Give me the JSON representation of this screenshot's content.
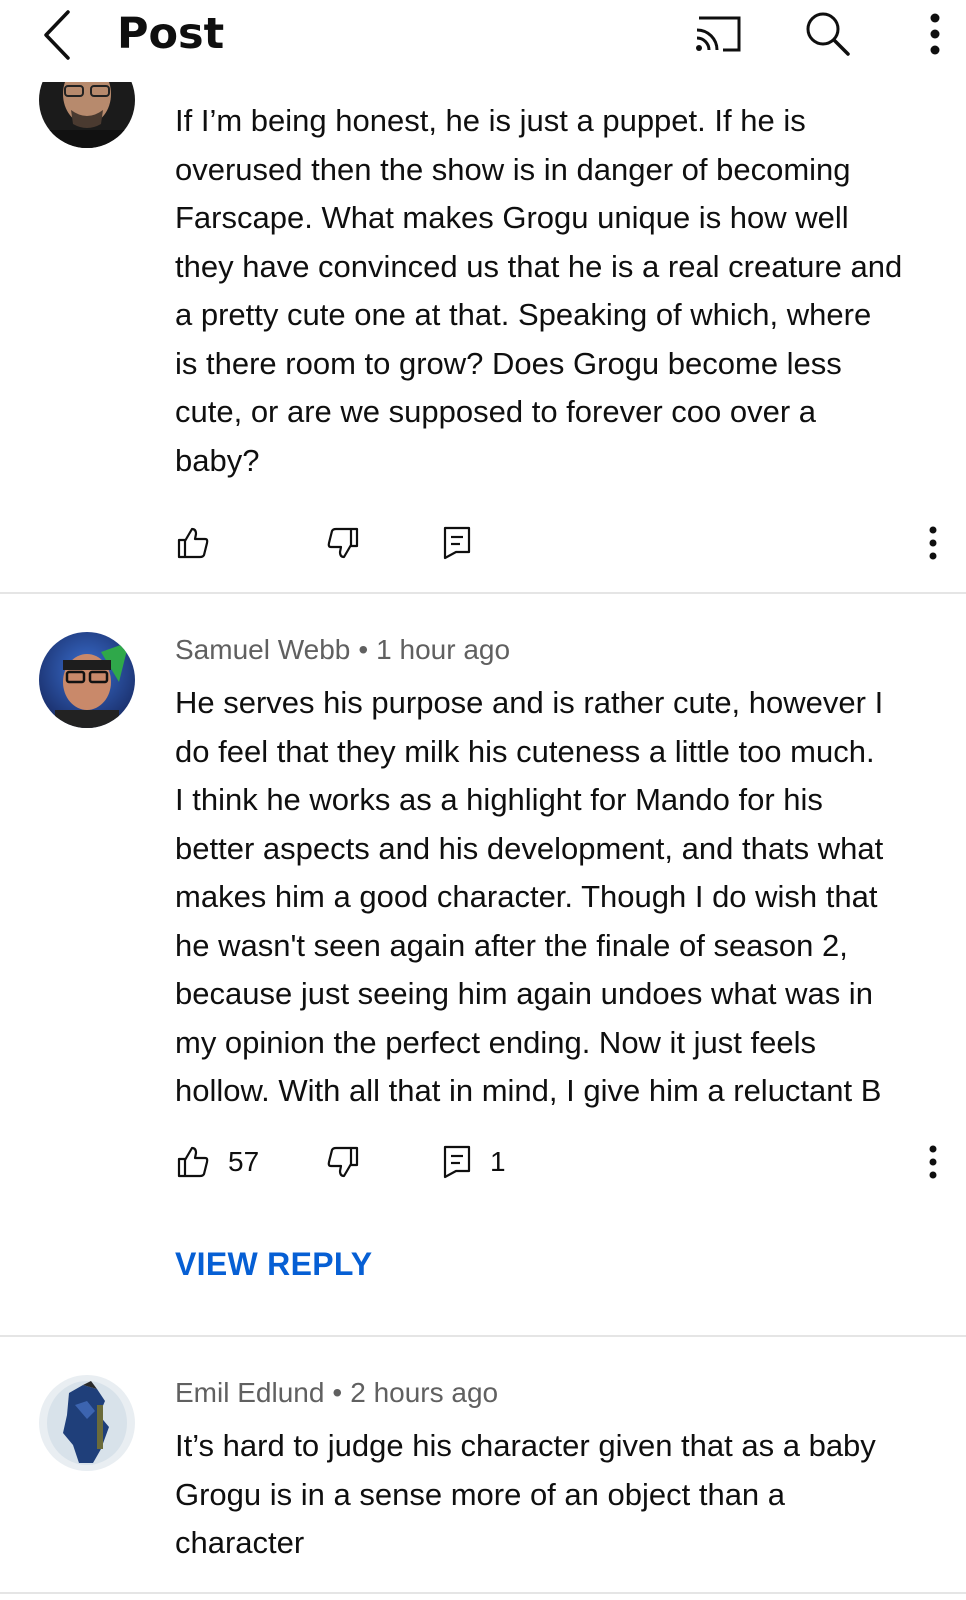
{
  "header": {
    "title": "Post",
    "back_icon": "chevron-left-icon",
    "cast_icon": "cast-icon",
    "search_icon": "search-icon",
    "more_icon": "more-vertical-icon"
  },
  "comments": [
    {
      "author": "",
      "time": "",
      "lines": [
        "If I’m being honest, he is just a puppet. If he is",
        "overused then the show is in danger of becoming",
        "Farscape. What makes Grogu unique is how well",
        "they have convinced us that he is a real creature and",
        "a pretty cute one at that.  Speaking of which, where",
        "is there room to grow?  Does Grogu become less",
        "cute, or are we supposed to forever coo over a",
        "baby?"
      ],
      "likes": "",
      "replies": ""
    },
    {
      "author": "Samuel Webb",
      "separator": "•",
      "time": "1 hour ago",
      "lines": [
        "He serves his purpose and is rather cute, however I",
        "do feel that they milk his cuteness a little too much.",
        "I think he works as a highlight for Mando for his",
        "better aspects and his development, and thats what",
        "makes him a good character. Though I do wish that",
        "he wasn't seen again after the finale of season 2,",
        "because just seeing him again undoes what was in",
        "my opinion the perfect ending. Now it just feels",
        "hollow. With all that in mind, I give him a reluctant B"
      ],
      "likes": "57",
      "replies": "1",
      "view_reply": "VIEW REPLY"
    },
    {
      "author": "Emil Edlund",
      "separator": "•",
      "time": "2 hours ago",
      "lines": [
        "It’s hard to judge his character given that as a baby",
        "Grogu is in a sense more of an object than a",
        "character"
      ]
    }
  ],
  "colors": {
    "link": "#065fd4",
    "meta": "#606060",
    "divider": "#e5e5e5",
    "text": "#0f0f0f"
  },
  "icons": {
    "like": "thumbs-up-icon",
    "dislike": "thumbs-down-icon",
    "reply": "reply-icon",
    "more": "more-vertical-icon"
  }
}
